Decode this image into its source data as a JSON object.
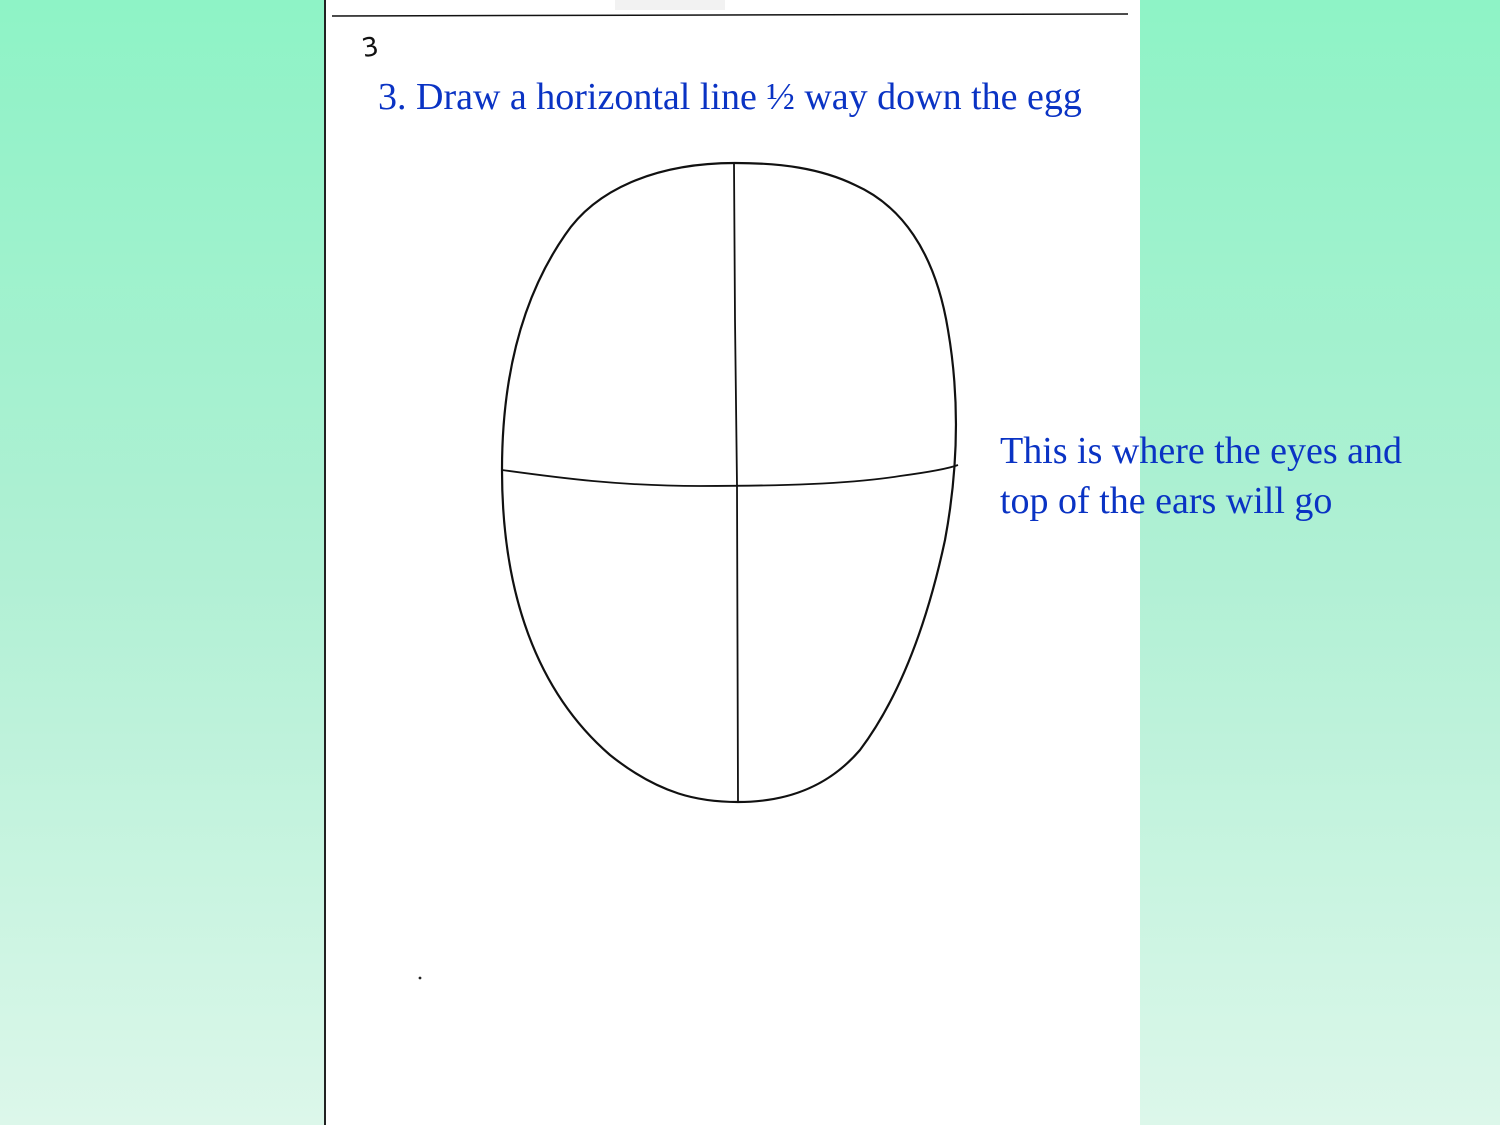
{
  "slide": {
    "page_mark": "3",
    "title": "3. Draw a horizontal line ½ way down the egg",
    "annotation": {
      "line1": "This is where the eyes and",
      "line2": "top of the ears will go"
    }
  },
  "colors": {
    "background_top": "#8ef3c6",
    "background_bottom": "#dcf7ea",
    "paper": "#ffffff",
    "text_blue": "#0a33c4",
    "ink": "#111111"
  }
}
